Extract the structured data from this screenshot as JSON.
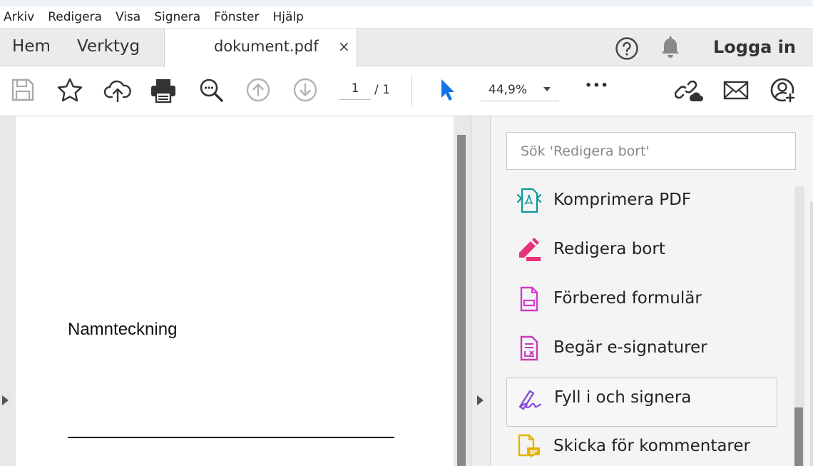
{
  "menubar": {
    "items": [
      "Arkiv",
      "Redigera",
      "Visa",
      "Signera",
      "Fönster",
      "Hjälp"
    ]
  },
  "tabs": {
    "home_label": "Hem",
    "tools_label": "Verktyg",
    "document_name": "dokument.pdf",
    "close_glyph": "×",
    "login_label": "Logga in"
  },
  "toolbar": {
    "icons": [
      "save-icon",
      "star-icon",
      "upload-cloud-icon",
      "print-icon",
      "zoom-out-icon",
      "page-up-icon",
      "page-down-icon",
      "select-pointer-icon",
      "more-icon",
      "share-link-icon",
      "mail-icon",
      "add-user-icon"
    ],
    "page_current": "1",
    "page_total": "/ 1",
    "zoom_value": "44,9%",
    "more_glyph": "•••"
  },
  "document": {
    "signature_label": "Namnteckning"
  },
  "tools_panel": {
    "search_placeholder": "Sök 'Redigera bort'",
    "items": [
      {
        "label": "Komprimera PDF",
        "icon": "compress-pdf-icon",
        "color": "#0d9a9a"
      },
      {
        "label": "Redigera bort",
        "icon": "redact-icon",
        "color": "#e8317a"
      },
      {
        "label": "Förbered formulär",
        "icon": "prepare-form-icon",
        "color": "#d03ad0"
      },
      {
        "label": "Begär e-signaturer",
        "icon": "request-esign-icon",
        "color": "#c63bb8"
      },
      {
        "label": "Fyll i och signera",
        "icon": "fill-sign-icon",
        "color": "#8a4dd6",
        "selected": true
      },
      {
        "label": "Skicka för kommentarer",
        "icon": "send-comment-icon",
        "color": "#e3b500"
      }
    ]
  },
  "colors": {
    "accent_blue": "#1473e6",
    "chrome_gray": "#ebebeb"
  }
}
